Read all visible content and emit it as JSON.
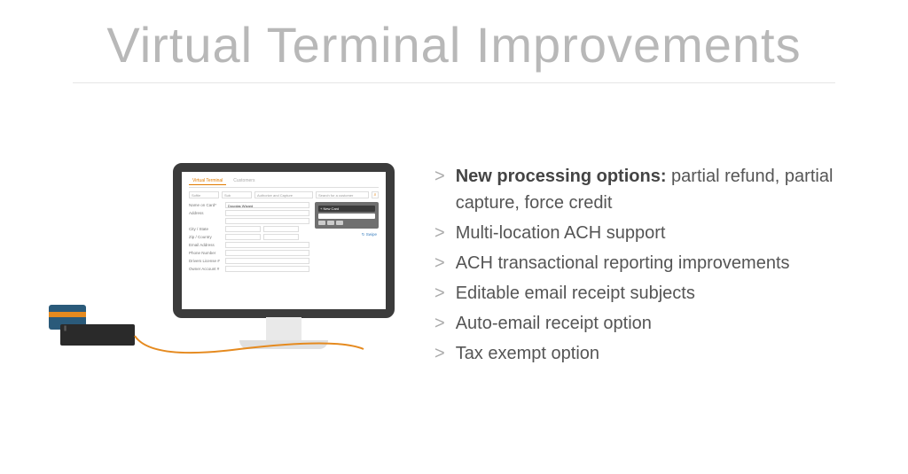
{
  "title": "Virtual Terminal Improvements",
  "bullets": [
    {
      "strong": "New processing options:",
      "rest": " partial refund, partial capture, force credit"
    },
    {
      "strong": "",
      "rest": "Multi-location ACH support"
    },
    {
      "strong": "",
      "rest": "ACH transactional reporting improvements"
    },
    {
      "strong": "",
      "rest": "Editable email receipt subjects"
    },
    {
      "strong": "",
      "rest": "Auto-email receipt option"
    },
    {
      "strong": "",
      "rest": "Tax exempt option"
    }
  ],
  "mock_screen": {
    "tabs": {
      "active": "Virtual Terminal",
      "other": "Customers"
    },
    "filters": {
      "a": "Softie",
      "b": "Sub",
      "c": "Authorize and Capture",
      "search": "Search for a customer"
    },
    "form": {
      "name_on_card_label": "Name on Card*",
      "name_on_card_value": "Douglas Wizard",
      "address_label": "Address",
      "city_state_label": "City / State",
      "zip_country_label": "Zip / Country",
      "email_label": "Email Address",
      "phone_label": "Phone Number",
      "drivers_license_label": "Drivers License #",
      "owner_account_label": "Owner Account #"
    },
    "card_widget": {
      "header": "+ New Card",
      "swipe": "Swipe"
    }
  }
}
